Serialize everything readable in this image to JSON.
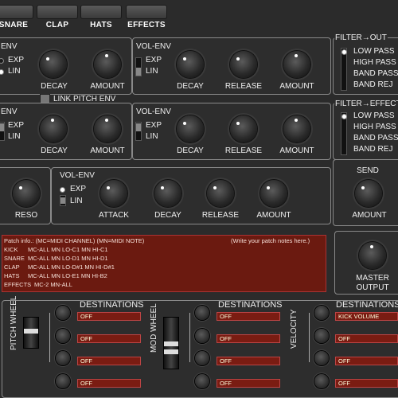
{
  "tabs": [
    "SNARE",
    "CLAP",
    "HATS",
    "EFFECTS"
  ],
  "row1": {
    "pitch_env": {
      "title": "ENV",
      "options": [
        "EXP",
        "LIN"
      ],
      "knobs": [
        "DECAY",
        "AMOUNT"
      ]
    },
    "vol_env": {
      "title": "VOL-ENV",
      "options": [
        "EXP",
        "LIN"
      ],
      "knobs": [
        "DECAY",
        "RELEASE",
        "AMOUNT"
      ]
    },
    "filter": {
      "title": "FILTER→OUT",
      "options": [
        "LOW PASS",
        "HIGH PASS",
        "BAND PASS",
        "BAND REJ"
      ]
    }
  },
  "link_pitch_env": "LINK PITCH ENV",
  "row2": {
    "pitch_env": {
      "title": "ENV",
      "options": [
        "EXP",
        "LIN"
      ],
      "knobs": [
        "DECAY",
        "AMOUNT"
      ]
    },
    "vol_env": {
      "title": "VOL-ENV",
      "options": [
        "EXP",
        "LIN"
      ],
      "knobs": [
        "DECAY",
        "RELEASE",
        "AMOUNT"
      ]
    },
    "filter": {
      "title": "FILTER→EFFECT",
      "options": [
        "LOW PASS",
        "HIGH PASS",
        "BAND PASS",
        "BAND REJ"
      ]
    }
  },
  "row3": {
    "reso_label": "RESO",
    "vol_env": {
      "title": "VOL-ENV",
      "options": [
        "EXP",
        "LIN"
      ],
      "knobs": [
        "ATTACK",
        "DECAY",
        "RELEASE",
        "AMOUNT"
      ]
    },
    "send": {
      "title": "SEND",
      "knob": "AMOUNT"
    }
  },
  "patch_info": {
    "header": "Patch info.: (MC=MIDI CHANNEL) (MN=MIDI NOTE)",
    "note": "(Write your patch notes here.)",
    "lines": [
      {
        "name": "KICK",
        "text": "MC-ALL    MN LO-C1 MN HI-C1"
      },
      {
        "name": "SNARE",
        "text": "MC-ALL    MN LO-D1 MN HI-D1"
      },
      {
        "name": "CLAP",
        "text": "MC-ALL    MN LO-D#1 MN HI-D#1"
      },
      {
        "name": "HATS",
        "text": "MC-ALL    MN LO-E1 MN HI-B2"
      },
      {
        "name": "EFFECTS",
        "text": "MC-2 MN-ALL"
      }
    ]
  },
  "master_output": [
    "MASTER",
    "OUTPUT"
  ],
  "modulation": [
    {
      "label": "PITCH WHEEL",
      "title": "DESTINATIONS",
      "slots": [
        "OFF",
        "OFF",
        "OFF",
        "OFF"
      ]
    },
    {
      "label": "MOD WHEEL",
      "title": "DESTINATIONS",
      "slots": [
        "OFF",
        "OFF",
        "OFF",
        "OFF"
      ]
    },
    {
      "label": "VELOCITY",
      "title": "DESTINATIONS",
      "slots": [
        "KICK VOLUME",
        "OFF",
        "OFF",
        "OFF"
      ]
    }
  ]
}
